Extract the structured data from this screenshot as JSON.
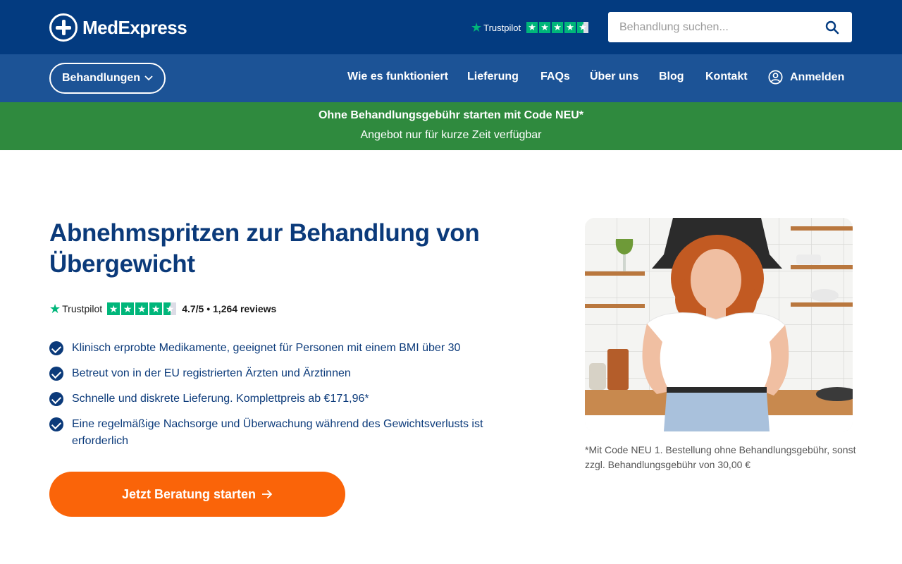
{
  "header": {
    "logo_text": "MedExpress",
    "trustpilot_label": "Trustpilot",
    "search": {
      "placeholder": "Behandlung suchen..."
    }
  },
  "nav": {
    "treatments_label": "Behandlungen",
    "links": [
      "Wie es funktioniert",
      "Lieferung",
      "FAQs",
      "Über uns",
      "Blog",
      "Kontakt"
    ],
    "login_label": "Anmelden"
  },
  "promo": {
    "title": "Ohne Behandlungsgebühr starten mit Code NEU*",
    "subtitle": "Angebot nur für kurze Zeit verfügbar"
  },
  "hero": {
    "title": "Abnehmspritzen zur Behandlung von Übergewicht",
    "trustpilot_label": "Trustpilot",
    "rating_text": "4.7/5 • 1,264 reviews",
    "benefits": [
      "Klinisch erprobte Medikamente, geeignet für Personen mit einem BMI über 30",
      "Betreut von in der EU registrierten Ärzten und Ärztinnen",
      "Schnelle und diskrete Lieferung. Komplettpreis ab €171,96*",
      "Eine regelmäßige Nachsorge und Überwachung während des Gewichtsverlusts ist erforderlich"
    ],
    "cta_label": "Jetzt Beratung starten",
    "footnote": "*Mit Code NEU 1. Bestellung ohne Behandlungsgebühr, sonst zzgl. Behandlungsgebühr von 30,00 €"
  },
  "colors": {
    "header_bg": "#033b80",
    "nav_bg": "#1c5396",
    "promo_bg": "#2f8a3e",
    "cta_bg": "#fa6409",
    "heading": "#0b3a7a",
    "trustpilot_green": "#00b67a"
  },
  "icons": [
    "medexpress-cross-logo-icon",
    "trustpilot-star-icon",
    "search-icon",
    "chevron-down-icon",
    "user-icon",
    "check-circle-icon",
    "arrow-right-icon"
  ]
}
